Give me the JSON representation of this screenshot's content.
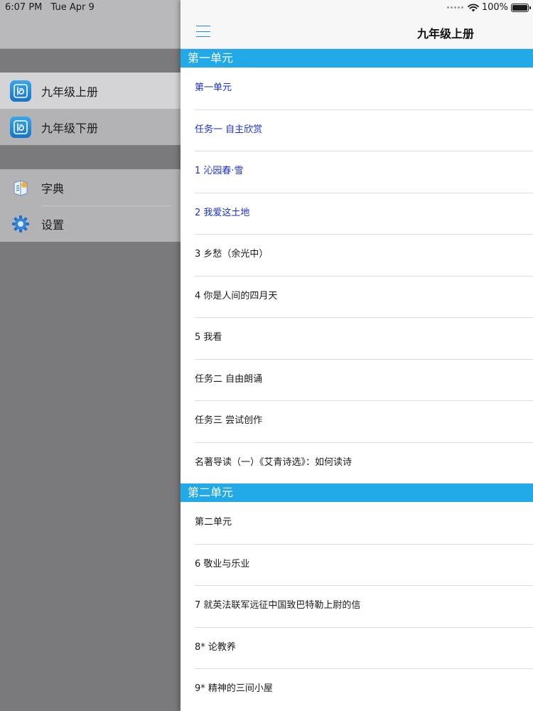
{
  "status_bar": {
    "time": "6:07 PM",
    "date": "Tue Apr 9",
    "battery": "100%",
    "battery_level": 1.0
  },
  "sidebar": {
    "books": [
      {
        "label": "九年级上册",
        "icon": "book-app-icon",
        "selected": true
      },
      {
        "label": "九年级下册",
        "icon": "book-app-icon",
        "selected": false
      }
    ],
    "tools": [
      {
        "label": "字典",
        "icon": "dictionary-icon"
      },
      {
        "label": "设置",
        "icon": "gear-icon"
      }
    ]
  },
  "content": {
    "menu_icon": "hamburger-menu-icon",
    "title": "九年级上册",
    "colors": {
      "section_header": "#22a9e8",
      "read_item": "#1a2fd1",
      "unread_item": "#1a1a1a",
      "menu_icon": "#1e8be6"
    },
    "sections": [
      {
        "title": "第一单元",
        "items": [
          {
            "label": "第一单元",
            "read": true
          },
          {
            "label": "任务一 自主欣赏",
            "read": true
          },
          {
            "label": "1 沁园春·雪",
            "read": true
          },
          {
            "label": "2 我爱这土地",
            "read": true
          },
          {
            "label": "3 乡愁（余光中）",
            "read": false
          },
          {
            "label": "4 你是人间的四月天",
            "read": false
          },
          {
            "label": "5 我看",
            "read": false
          },
          {
            "label": "任务二 自由朗诵",
            "read": false
          },
          {
            "label": "任务三 尝试创作",
            "read": false
          },
          {
            "label": "名著导读（一）《艾青诗选》：如何读诗",
            "read": false
          }
        ]
      },
      {
        "title": "第二单元",
        "items": [
          {
            "label": "第二单元",
            "read": false
          },
          {
            "label": "6 敬业与乐业",
            "read": false
          },
          {
            "label": "7 就英法联军远征中国致巴特勒上尉的信",
            "read": false
          },
          {
            "label": "8* 论教养",
            "read": false
          },
          {
            "label": "9* 精神的三间小屋",
            "read": false
          }
        ]
      }
    ]
  }
}
